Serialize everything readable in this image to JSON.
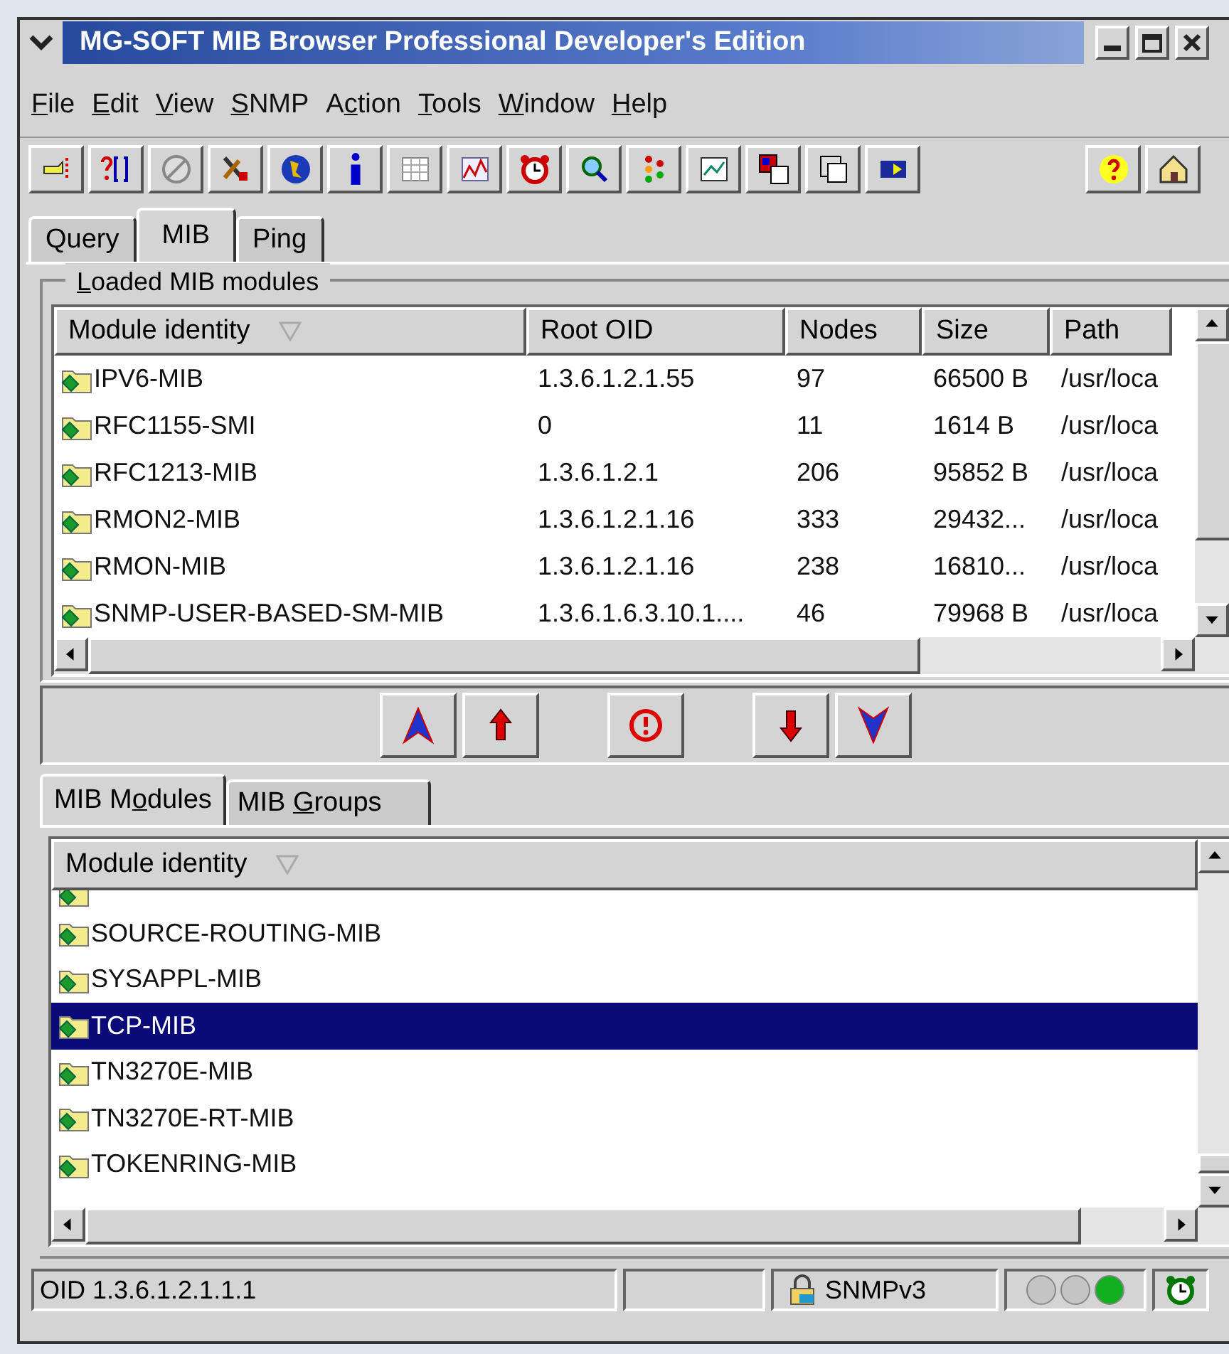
{
  "window": {
    "title": "MG-SOFT MIB Browser Professional Developer's Edition"
  },
  "menu": [
    {
      "parts": {
        "key": "F",
        "after": "ile"
      }
    },
    {
      "parts": {
        "key": "E",
        "after": "dit"
      }
    },
    {
      "parts": {
        "key": "V",
        "after": "iew"
      }
    },
    {
      "parts": {
        "key": "S",
        "after": "NMP"
      }
    },
    {
      "parts": {
        "before": "A",
        "key": "c",
        "after": "tion"
      }
    },
    {
      "parts": {
        "key": "T",
        "after": "ools"
      }
    },
    {
      "parts": {
        "key": "W",
        "after": "indow"
      }
    },
    {
      "parts": {
        "key": "H",
        "after": "elp"
      }
    }
  ],
  "tabs": [
    {
      "label": "Query",
      "selected": false
    },
    {
      "label": "MIB",
      "selected": true
    },
    {
      "label": "Ping",
      "selected": false
    }
  ],
  "loaded_modules": {
    "title_parts": {
      "key": "L",
      "after": "oaded MIB modules"
    },
    "columns": [
      {
        "label": "Module identity",
        "sorted": true
      },
      {
        "label": "Root OID",
        "sorted": false
      },
      {
        "label": "Nodes",
        "sorted": false
      },
      {
        "label": "Size",
        "sorted": false
      },
      {
        "label": "Path",
        "sorted": false
      }
    ],
    "rows": [
      [
        "IPV6-MIB",
        "1.3.6.1.2.1.55",
        "97",
        "66500 B",
        "/usr/loca"
      ],
      [
        "RFC1155-SMI",
        "0",
        "11",
        "1614 B",
        "/usr/loca"
      ],
      [
        "RFC1213-MIB",
        "1.3.6.1.2.1",
        "206",
        "95852 B",
        "/usr/loca"
      ],
      [
        "RMON2-MIB",
        "1.3.6.1.2.1.16",
        "333",
        "29432...",
        "/usr/loca"
      ],
      [
        "RMON-MIB",
        "1.3.6.1.2.1.16",
        "238",
        "16810...",
        "/usr/loca"
      ],
      [
        "SNMP-USER-BASED-SM-MIB",
        "1.3.6.1.6.3.10.1....",
        "46",
        "79968 B",
        "/usr/loca"
      ]
    ]
  },
  "lower_tabs": [
    {
      "parts": {
        "before": "MIB M",
        "key": "o",
        "after": "dules"
      },
      "selected": true
    },
    {
      "parts": {
        "before": "MIB ",
        "key": "G",
        "after": "roups"
      },
      "selected": false
    }
  ],
  "modules_list": {
    "column": {
      "label": "Module identity",
      "sorted": true
    },
    "rows": [
      {
        "label": "SOURCE-ROUTING-MIB",
        "selected": false
      },
      {
        "label": "SYSAPPL-MIB",
        "selected": false
      },
      {
        "label": "TCP-MIB",
        "selected": true
      },
      {
        "label": "TN3270E-MIB",
        "selected": false
      },
      {
        "label": "TN3270E-RT-MIB",
        "selected": false
      },
      {
        "label": "TOKENRING-MIB",
        "selected": false
      }
    ]
  },
  "status_bar": {
    "oid": "OID 1.3.6.1.2.1.1.1",
    "protocol": "SNMPv3",
    "lights": [
      {
        "on": false
      },
      {
        "on": false
      },
      {
        "on": true
      }
    ]
  }
}
